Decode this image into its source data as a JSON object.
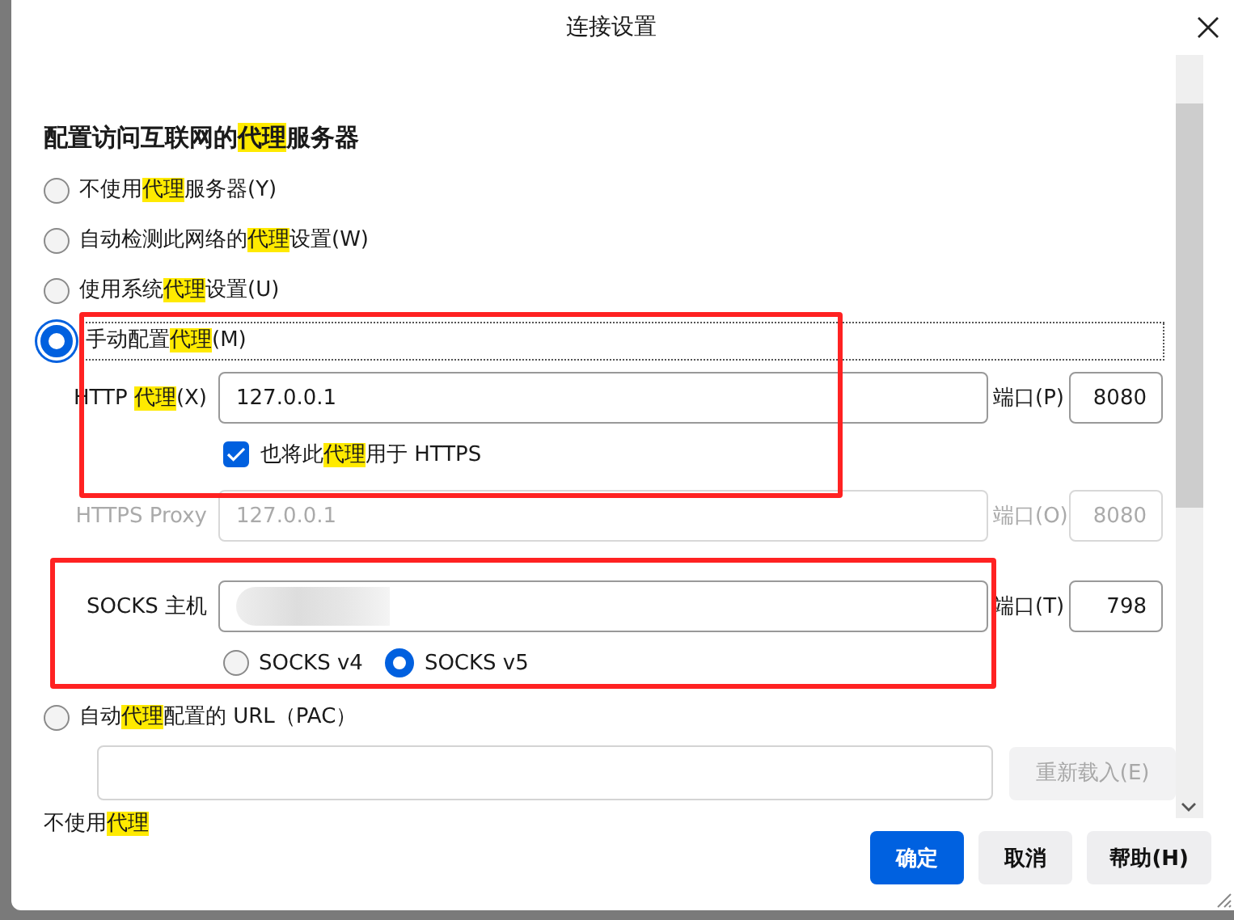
{
  "window": {
    "title": "连接设置"
  },
  "heading": "配置访问互联网的**代理**服务器",
  "modes": [
    {
      "kind": "plain",
      "selected": false,
      "label": "不使用**代理**服务器(Y)"
    },
    {
      "kind": "plain",
      "selected": false,
      "label": "自动检测此网络的**代理**设置(W)"
    },
    {
      "kind": "plain",
      "selected": false,
      "label": "使用系统**代理**设置(U)"
    },
    {
      "kind": "manual",
      "selected": true,
      "label": "手动配置**代理**(M)"
    },
    {
      "kind": "pac",
      "selected": false,
      "label": "自动**代理**配置的 URL（PAC）"
    }
  ],
  "manual": {
    "http": {
      "disabled": false,
      "label": "HTTP **代理**(X)",
      "value": "127.0.0.1",
      "port_label": "端口(P)",
      "port": "8080"
    },
    "also_https": {
      "checked": true,
      "label": "也将此**代理**用于 HTTPS"
    },
    "https": {
      "disabled": true,
      "label": "HTTPS Proxy",
      "value": "127.0.0.1",
      "port_label": "端口(O)",
      "port": "8080"
    },
    "socks": {
      "disabled": false,
      "redacted": true,
      "label": "SOCKS 主机",
      "port_label": "端口(T)",
      "port": "798"
    },
    "socks_versions": [
      {
        "selected": false,
        "label": "SOCKS v4"
      },
      {
        "selected": true,
        "label": "SOCKS v5"
      }
    ]
  },
  "pac": {
    "reload": {
      "disabled": true,
      "label": "重新载入(E)"
    }
  },
  "partial_row": "不使用**代理**",
  "buttons": [
    {
      "kind": "primary",
      "label": "确定"
    },
    {
      "kind": "secondary",
      "label": "取消"
    },
    {
      "kind": "secondary",
      "label": "帮助(H)"
    }
  ]
}
